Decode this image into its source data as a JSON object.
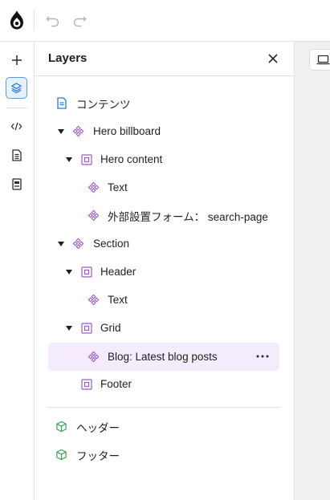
{
  "top_bar": {
    "logo_icon": "drupal-drop-icon",
    "undo_icon": "undo-icon",
    "redo_icon": "redo-icon"
  },
  "rail": {
    "items": [
      {
        "icon": "plus-icon",
        "active": false
      },
      {
        "icon": "layers-icon",
        "active": true
      },
      {
        "icon": "code-icon",
        "active": false
      },
      {
        "icon": "document-icon",
        "active": false
      },
      {
        "icon": "template-icon",
        "active": false
      }
    ],
    "accent_color": "#2a7ad0"
  },
  "panel": {
    "title": "Layers",
    "close_icon": "close-icon"
  },
  "tree": {
    "content": {
      "label": "コンテンツ",
      "icon": "document-icon"
    },
    "hero_billboard": {
      "label": "Hero billboard",
      "icon": "component-icon",
      "expanded": true
    },
    "hero_content": {
      "label": "Hero content",
      "icon": "slot-icon",
      "expanded": true
    },
    "hero_text": {
      "label": "Text",
      "icon": "component-icon"
    },
    "search_form": {
      "label": "外部設置フォーム： search-page",
      "icon": "component-icon"
    },
    "section": {
      "label": "Section",
      "icon": "component-icon",
      "expanded": true
    },
    "header": {
      "label": "Header",
      "icon": "slot-icon",
      "expanded": true
    },
    "header_text": {
      "label": "Text",
      "icon": "component-icon"
    },
    "grid": {
      "label": "Grid",
      "icon": "slot-icon",
      "expanded": true
    },
    "blog": {
      "label": "Blog: Latest blog posts",
      "icon": "component-icon",
      "selected": true
    },
    "footer": {
      "label": "Footer",
      "icon": "slot-icon"
    }
  },
  "regions": {
    "header_region": {
      "label": "ヘッダー",
      "icon": "cube-icon"
    },
    "footer_region": {
      "label": "フッター",
      "icon": "cube-icon"
    }
  },
  "colors": {
    "component": "#9b59d0",
    "slot": "#9b59d0",
    "region": "#2e9e4f",
    "document": "#2a7ad0",
    "selected_bg": "#f4ebfc"
  },
  "canvas": {
    "device_icon": "laptop-icon"
  }
}
